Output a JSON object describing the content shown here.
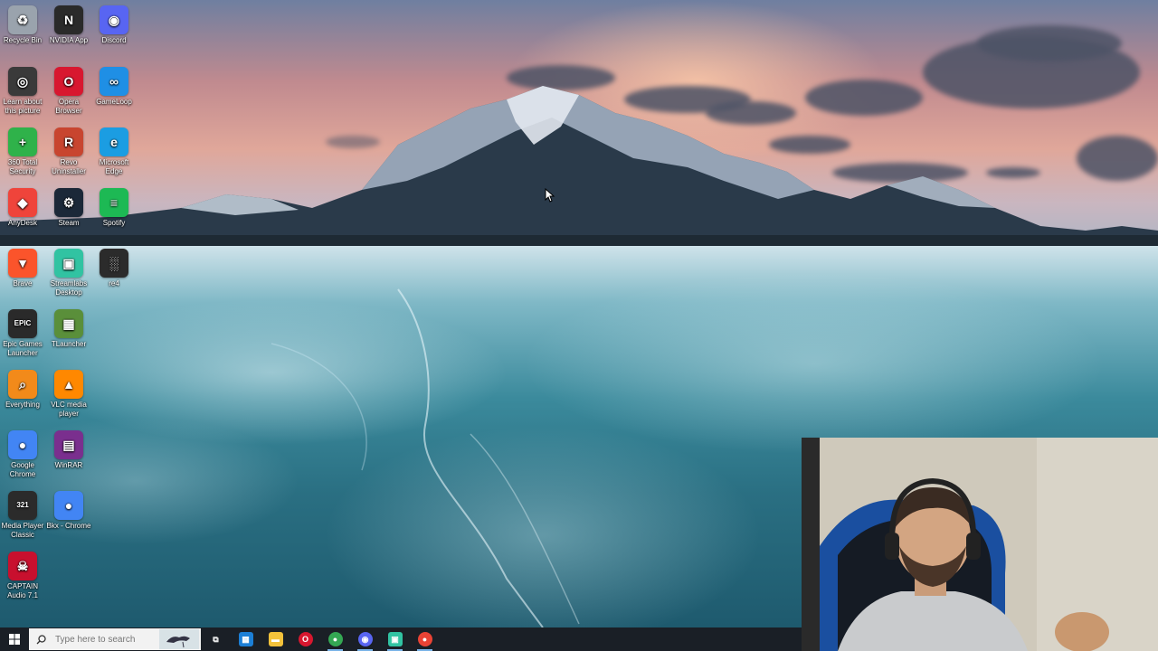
{
  "desktop": {
    "icons": [
      {
        "label": "Recycle Bin",
        "icon": "recycle-bin-icon",
        "color": "#9aa3ad",
        "glyph": "♻"
      },
      {
        "label": "NVIDIA App",
        "icon": "nvidia-icon",
        "color": "#2a2a2a",
        "glyph": "N"
      },
      {
        "label": "Discord",
        "icon": "discord-icon",
        "color": "#5865F2",
        "glyph": "◉"
      },
      {
        "label": "Learn about this picture",
        "icon": "camera-icon",
        "color": "#3a3a3a",
        "glyph": "◎"
      },
      {
        "label": "Opera Browser",
        "icon": "opera-icon",
        "color": "#d8172f",
        "glyph": "O"
      },
      {
        "label": "GameLoop",
        "icon": "gameloop-icon",
        "color": "#1f8fe5",
        "glyph": "∞"
      },
      {
        "label": "360 Total Security",
        "icon": "shield-plus-icon",
        "color": "#2fb24a",
        "glyph": "+"
      },
      {
        "label": "Revo Uninstaller",
        "icon": "revo-icon",
        "color": "#c8452f",
        "glyph": "R"
      },
      {
        "label": "Microsoft Edge",
        "icon": "edge-icon",
        "color": "#1b9de2",
        "glyph": "e"
      },
      {
        "label": "AnyDesk",
        "icon": "anydesk-icon",
        "color": "#ef443b",
        "glyph": "◆"
      },
      {
        "label": "Steam",
        "icon": "steam-icon",
        "color": "#1b2838",
        "glyph": "⚙"
      },
      {
        "label": "Spotify",
        "icon": "spotify-icon",
        "color": "#1db954",
        "glyph": "≡"
      },
      {
        "label": "Brave",
        "icon": "brave-icon",
        "color": "#fb542b",
        "glyph": "▼"
      },
      {
        "label": "Streamlabs Desktop",
        "icon": "streamlabs-icon",
        "color": "#31c3a2",
        "glyph": "▣"
      },
      {
        "label": "re4",
        "icon": "re4-icon",
        "color": "#2b2b2b",
        "glyph": "░"
      },
      {
        "label": "Epic Games Launcher",
        "icon": "epic-games-icon",
        "color": "#2a2a2a",
        "glyph": "EPIC"
      },
      {
        "label": "TLauncher",
        "icon": "minecraft-icon",
        "color": "#5a8f3a",
        "glyph": "▦"
      },
      {
        "label": "Everything",
        "icon": "everything-icon",
        "color": "#f28a1a",
        "glyph": "⌕"
      },
      {
        "label": "VLC media player",
        "icon": "vlc-icon",
        "color": "#ff8800",
        "glyph": "▲"
      },
      {
        "label": "Google Chrome",
        "icon": "chrome-icon",
        "color": "#4285f4",
        "glyph": "●"
      },
      {
        "label": "WinRAR",
        "icon": "winrar-icon",
        "color": "#7a2f8e",
        "glyph": "▤"
      },
      {
        "label": "Media Player Classic",
        "icon": "media-player-icon",
        "color": "#2b2b2b",
        "glyph": "321"
      },
      {
        "label": "Bkx - Chrome",
        "icon": "chrome-icon",
        "color": "#4285f4",
        "glyph": "●"
      },
      {
        "label": "CAPTAIN Audio 7.1",
        "icon": "captain-audio-icon",
        "color": "#c8102e",
        "glyph": "☠"
      }
    ]
  },
  "taskbar": {
    "search_placeholder": "Type here to search",
    "pinned": [
      {
        "name": "task-view-icon",
        "color": "#1a1f26",
        "glyph": "⧉"
      },
      {
        "name": "microsoft-store-icon",
        "color": "#1c7fd6",
        "glyph": "▦"
      },
      {
        "name": "file-explorer-icon",
        "color": "#f3c23b",
        "glyph": "▬"
      },
      {
        "name": "opera-icon",
        "color": "#d8172f",
        "glyph": "O"
      },
      {
        "name": "chrome-icon",
        "color": "#34a853",
        "glyph": "●"
      },
      {
        "name": "discord-icon",
        "color": "#5865F2",
        "glyph": "◉"
      },
      {
        "name": "streamlabs-icon",
        "color": "#31c3a2",
        "glyph": "▣"
      },
      {
        "name": "chrome-icon",
        "color": "#ea4335",
        "glyph": "●"
      }
    ]
  }
}
